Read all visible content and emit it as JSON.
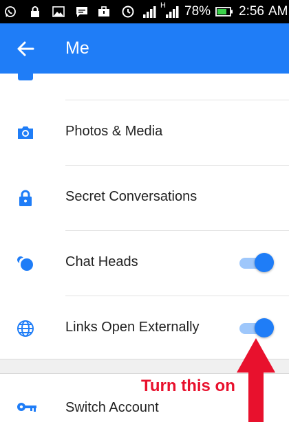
{
  "status_bar": {
    "battery_percent": "78%",
    "time": "2:56",
    "ampm": "AM",
    "network_type": "H"
  },
  "header": {
    "title": "Me"
  },
  "rows": [
    {
      "label": "Photos & Media",
      "icon": "camera-icon"
    },
    {
      "label": "Secret Conversations",
      "icon": "lock-icon"
    },
    {
      "label": "Chat Heads",
      "icon": "chat-heads-icon",
      "toggle": true
    },
    {
      "label": "Links Open Externally",
      "icon": "globe-icon",
      "toggle": true
    },
    {
      "label": "Switch Account",
      "icon": "key-icon"
    }
  ],
  "annotation": {
    "text": "Turn this on"
  },
  "colors": {
    "accent": "#1f7df7",
    "annotation": "#e8112d"
  }
}
